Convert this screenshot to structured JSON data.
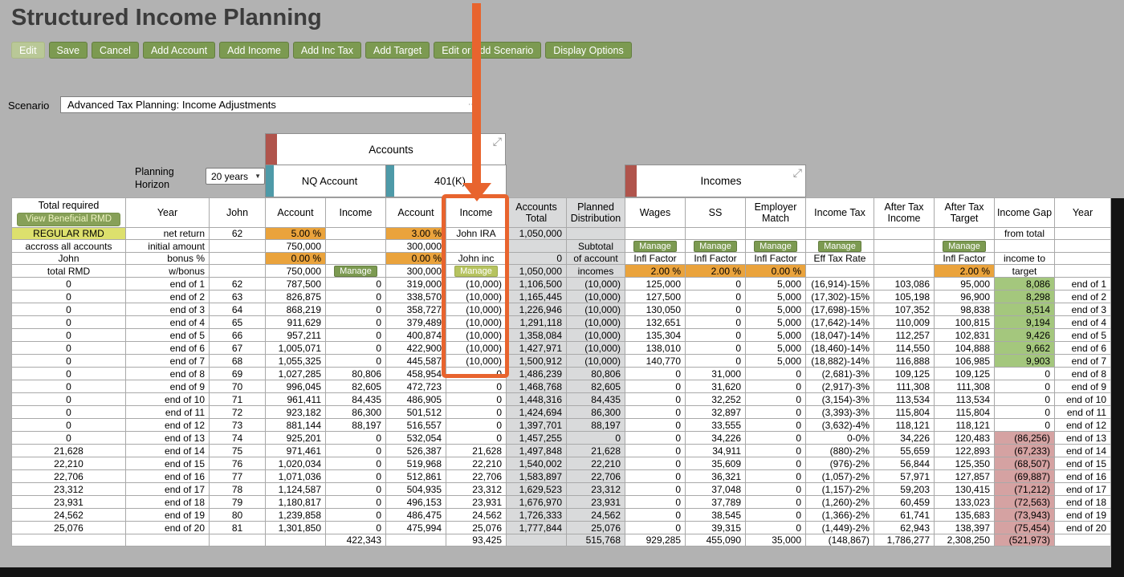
{
  "title": "Structured Income Planning",
  "toolbar": {
    "buttons": [
      {
        "label": "Edit",
        "disabled": true
      },
      {
        "label": "Save"
      },
      {
        "label": "Cancel"
      },
      {
        "label": "Add Account"
      },
      {
        "label": "Add Income"
      },
      {
        "label": "Add Inc Tax"
      },
      {
        "label": "Add Target"
      },
      {
        "label": "Edit or Add Scenario"
      },
      {
        "label": "Display Options"
      }
    ]
  },
  "scenario": {
    "label": "Scenario",
    "value": "Advanced Tax Planning: Income Adjustments"
  },
  "planning_horizon": {
    "label": "Planning Horizon",
    "value": "20 years"
  },
  "groups": {
    "accounts": "Accounts",
    "incomes": "Incomes",
    "nq_account": "NQ Account",
    "k401": "401(K)"
  },
  "icons": {
    "expand": "⤢",
    "dropdown": "⋯",
    "select_arrow": "▼"
  },
  "colors": {
    "accent_orange": "#E8642E",
    "button_green": "#7C9A51",
    "rate_orange": "#EAA33C",
    "rmd_yellow": "#DDE06D",
    "gap_positive_green": "#A4C77D",
    "gap_negative_pink": "#D5A2A2",
    "teal_bar": "#4E9AA8",
    "maroon_bar": "#B0544C"
  },
  "table": {
    "header": {
      "total_required": "Total required",
      "view_beneficial_rmd": "View Beneficial RMD",
      "columns": [
        "Year",
        "John",
        "Account",
        "Income",
        "Account",
        "Income",
        "Accounts Total",
        "Planned Distribution",
        "Wages",
        "SS",
        "Employer Match",
        "Income Tax",
        "After Tax Income",
        "After Tax Target",
        "Income Gap",
        "Year"
      ]
    },
    "subheaders": [
      [
        {
          "t": "REGULAR RMD",
          "k": "y"
        },
        {
          "t": "net return",
          "k": "r"
        },
        {
          "t": "62",
          "k": "c"
        },
        {
          "t": "5.00 %",
          "k": "o"
        },
        "",
        {
          "t": "3.00 %",
          "k": "o"
        },
        {
          "t": "John IRA",
          "k": "c"
        },
        {
          "t": "1,050,000",
          "k": "r"
        },
        "",
        "",
        "",
        "",
        "",
        "",
        "",
        {
          "t": "from total",
          "k": "c"
        },
        ""
      ],
      [
        {
          "t": "accross all accounts",
          "k": "c"
        },
        {
          "t": "initial amount",
          "k": "r"
        },
        "",
        {
          "t": "750,000",
          "k": "r"
        },
        "",
        {
          "t": "300,000",
          "k": "r"
        },
        "",
        "",
        {
          "t": "Subtotal",
          "k": "c"
        },
        {
          "t": "Manage",
          "k": "b"
        },
        {
          "t": "Manage",
          "k": "b"
        },
        {
          "t": "Manage",
          "k": "b"
        },
        {
          "t": "Manage",
          "k": "b"
        },
        "",
        {
          "t": "Manage",
          "k": "b"
        },
        "",
        ""
      ],
      [
        {
          "t": "John",
          "k": "c"
        },
        {
          "t": "bonus %",
          "k": "r"
        },
        "",
        {
          "t": "0.00 %",
          "k": "o"
        },
        "",
        {
          "t": "0.00 %",
          "k": "o"
        },
        {
          "t": "John inc",
          "k": "c"
        },
        {
          "t": "0",
          "k": "r"
        },
        {
          "t": "of account",
          "k": "c"
        },
        {
          "t": "Infl Factor",
          "k": "c"
        },
        {
          "t": "Infl Factor",
          "k": "c"
        },
        {
          "t": "Infl Factor",
          "k": "c"
        },
        {
          "t": "Eff Tax Rate",
          "k": "c"
        },
        "",
        {
          "t": "Infl Factor",
          "k": "c"
        },
        {
          "t": "income to",
          "k": "c"
        },
        ""
      ],
      [
        {
          "t": "total RMD",
          "k": "c"
        },
        {
          "t": "w/bonus",
          "k": "r"
        },
        "",
        {
          "t": "750,000",
          "k": "r"
        },
        {
          "t": "Manage",
          "k": "b"
        },
        {
          "t": "300,000",
          "k": "r"
        },
        {
          "t": "Manage",
          "k": "bh"
        },
        {
          "t": "1,050,000",
          "k": "r"
        },
        {
          "t": "incomes",
          "k": "c"
        },
        {
          "t": "2.00 %",
          "k": "o"
        },
        {
          "t": "2.00 %",
          "k": "o"
        },
        {
          "t": "0.00 %",
          "k": "o"
        },
        "",
        "",
        {
          "t": "2.00 %",
          "k": "o"
        },
        {
          "t": "target",
          "k": "c"
        },
        ""
      ]
    ],
    "rows": [
      [
        "0",
        "end of 1",
        "62",
        "787,500",
        "0",
        "319,000",
        "(10,000)",
        "1,106,500",
        "(10,000)",
        "125,000",
        "0",
        "5,000",
        "(16,914)-15%",
        "103,086",
        "95,000",
        "8,086",
        "end of 1"
      ],
      [
        "0",
        "end of 2",
        "63",
        "826,875",
        "0",
        "338,570",
        "(10,000)",
        "1,165,445",
        "(10,000)",
        "127,500",
        "0",
        "5,000",
        "(17,302)-15%",
        "105,198",
        "96,900",
        "8,298",
        "end of 2"
      ],
      [
        "0",
        "end of 3",
        "64",
        "868,219",
        "0",
        "358,727",
        "(10,000)",
        "1,226,946",
        "(10,000)",
        "130,050",
        "0",
        "5,000",
        "(17,698)-15%",
        "107,352",
        "98,838",
        "8,514",
        "end of 3"
      ],
      [
        "0",
        "end of 4",
        "65",
        "911,629",
        "0",
        "379,489",
        "(10,000)",
        "1,291,118",
        "(10,000)",
        "132,651",
        "0",
        "5,000",
        "(17,642)-14%",
        "110,009",
        "100,815",
        "9,194",
        "end of 4"
      ],
      [
        "0",
        "end of 5",
        "66",
        "957,211",
        "0",
        "400,874",
        "(10,000)",
        "1,358,084",
        "(10,000)",
        "135,304",
        "0",
        "5,000",
        "(18,047)-14%",
        "112,257",
        "102,831",
        "9,426",
        "end of 5"
      ],
      [
        "0",
        "end of 6",
        "67",
        "1,005,071",
        "0",
        "422,900",
        "(10,000)",
        "1,427,971",
        "(10,000)",
        "138,010",
        "0",
        "5,000",
        "(18,460)-14%",
        "114,550",
        "104,888",
        "9,662",
        "end of 6"
      ],
      [
        "0",
        "end of 7",
        "68",
        "1,055,325",
        "0",
        "445,587",
        "(10,000)",
        "1,500,912",
        "(10,000)",
        "140,770",
        "0",
        "5,000",
        "(18,882)-14%",
        "116,888",
        "106,985",
        "9,903",
        "end of 7"
      ],
      [
        "0",
        "end of 8",
        "69",
        "1,027,285",
        "80,806",
        "458,954",
        "0",
        "1,486,239",
        "80,806",
        "0",
        "31,000",
        "0",
        "(2,681)-3%",
        "109,125",
        "109,125",
        "0",
        "end of 8"
      ],
      [
        "0",
        "end of 9",
        "70",
        "996,045",
        "82,605",
        "472,723",
        "0",
        "1,468,768",
        "82,605",
        "0",
        "31,620",
        "0",
        "(2,917)-3%",
        "111,308",
        "111,308",
        "0",
        "end of 9"
      ],
      [
        "0",
        "end of 10",
        "71",
        "961,411",
        "84,435",
        "486,905",
        "0",
        "1,448,316",
        "84,435",
        "0",
        "32,252",
        "0",
        "(3,154)-3%",
        "113,534",
        "113,534",
        "0",
        "end of 10"
      ],
      [
        "0",
        "end of 11",
        "72",
        "923,182",
        "86,300",
        "501,512",
        "0",
        "1,424,694",
        "86,300",
        "0",
        "32,897",
        "0",
        "(3,393)-3%",
        "115,804",
        "115,804",
        "0",
        "end of 11"
      ],
      [
        "0",
        "end of 12",
        "73",
        "881,144",
        "88,197",
        "516,557",
        "0",
        "1,397,701",
        "88,197",
        "0",
        "33,555",
        "0",
        "(3,632)-4%",
        "118,121",
        "118,121",
        "0",
        "end of 12"
      ],
      [
        "0",
        "end of 13",
        "74",
        "925,201",
        "0",
        "532,054",
        "0",
        "1,457,255",
        "0",
        "0",
        "34,226",
        "0",
        "0-0%",
        "34,226",
        "120,483",
        "(86,256)",
        "end of 13"
      ],
      [
        "21,628",
        "end of 14",
        "75",
        "971,461",
        "0",
        "526,387",
        "21,628",
        "1,497,848",
        "21,628",
        "0",
        "34,911",
        "0",
        "(880)-2%",
        "55,659",
        "122,893",
        "(67,233)",
        "end of 14"
      ],
      [
        "22,210",
        "end of 15",
        "76",
        "1,020,034",
        "0",
        "519,968",
        "22,210",
        "1,540,002",
        "22,210",
        "0",
        "35,609",
        "0",
        "(976)-2%",
        "56,844",
        "125,350",
        "(68,507)",
        "end of 15"
      ],
      [
        "22,706",
        "end of 16",
        "77",
        "1,071,036",
        "0",
        "512,861",
        "22,706",
        "1,583,897",
        "22,706",
        "0",
        "36,321",
        "0",
        "(1,057)-2%",
        "57,971",
        "127,857",
        "(69,887)",
        "end of 16"
      ],
      [
        "23,312",
        "end of 17",
        "78",
        "1,124,587",
        "0",
        "504,935",
        "23,312",
        "1,629,523",
        "23,312",
        "0",
        "37,048",
        "0",
        "(1,157)-2%",
        "59,203",
        "130,415",
        "(71,212)",
        "end of 17"
      ],
      [
        "23,931",
        "end of 18",
        "79",
        "1,180,817",
        "0",
        "496,153",
        "23,931",
        "1,676,970",
        "23,931",
        "0",
        "37,789",
        "0",
        "(1,260)-2%",
        "60,459",
        "133,023",
        "(72,563)",
        "end of 18"
      ],
      [
        "24,562",
        "end of 19",
        "80",
        "1,239,858",
        "0",
        "486,475",
        "24,562",
        "1,726,333",
        "24,562",
        "0",
        "38,545",
        "0",
        "(1,366)-2%",
        "61,741",
        "135,683",
        "(73,943)",
        "end of 19"
      ],
      [
        "25,076",
        "end of 20",
        "81",
        "1,301,850",
        "0",
        "475,994",
        "25,076",
        "1,777,844",
        "25,076",
        "0",
        "39,315",
        "0",
        "(1,449)-2%",
        "62,943",
        "138,397",
        "(75,454)",
        "end of 20"
      ]
    ],
    "footer": [
      "",
      "",
      "",
      "",
      "422,343",
      "",
      "93,425",
      "",
      "515,768",
      "929,285",
      "455,090",
      "35,000",
      "(148,867)",
      "1,786,277",
      "2,308,250",
      "(521,973)",
      ""
    ]
  }
}
